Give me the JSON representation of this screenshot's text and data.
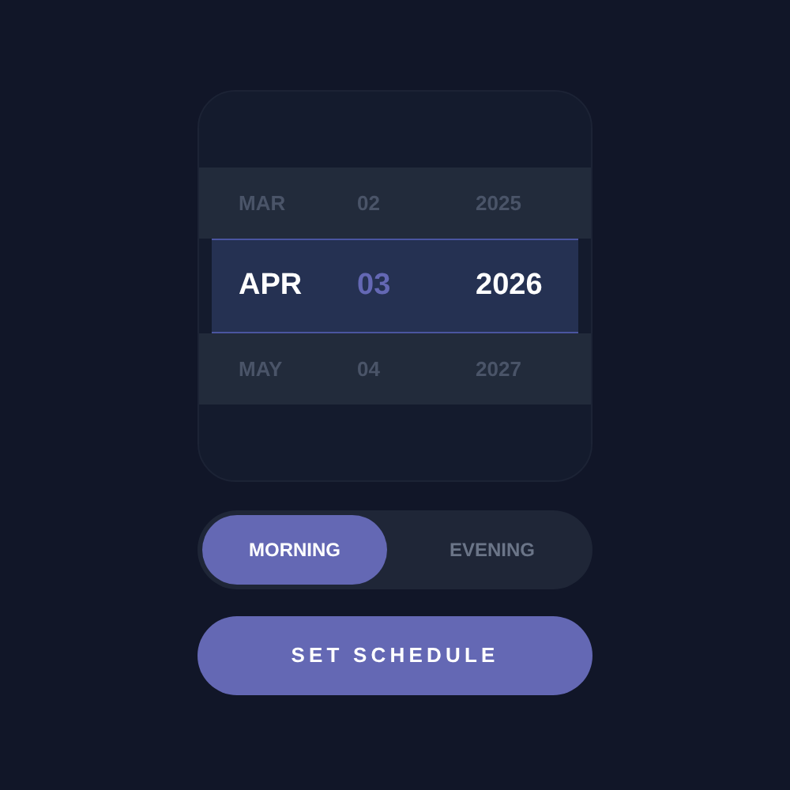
{
  "date_picker": {
    "rows": [
      {
        "month": "MAR",
        "day": "02",
        "year": "2025",
        "selected": false
      },
      {
        "month": "APR",
        "day": "03",
        "year": "2026",
        "selected": true
      },
      {
        "month": "MAY",
        "day": "04",
        "year": "2027",
        "selected": false
      }
    ]
  },
  "time_of_day": [
    {
      "label": "MORNING",
      "selected": true
    },
    {
      "label": "EVENING",
      "selected": false
    }
  ],
  "button": {
    "label": "SET SCHEDULE"
  }
}
